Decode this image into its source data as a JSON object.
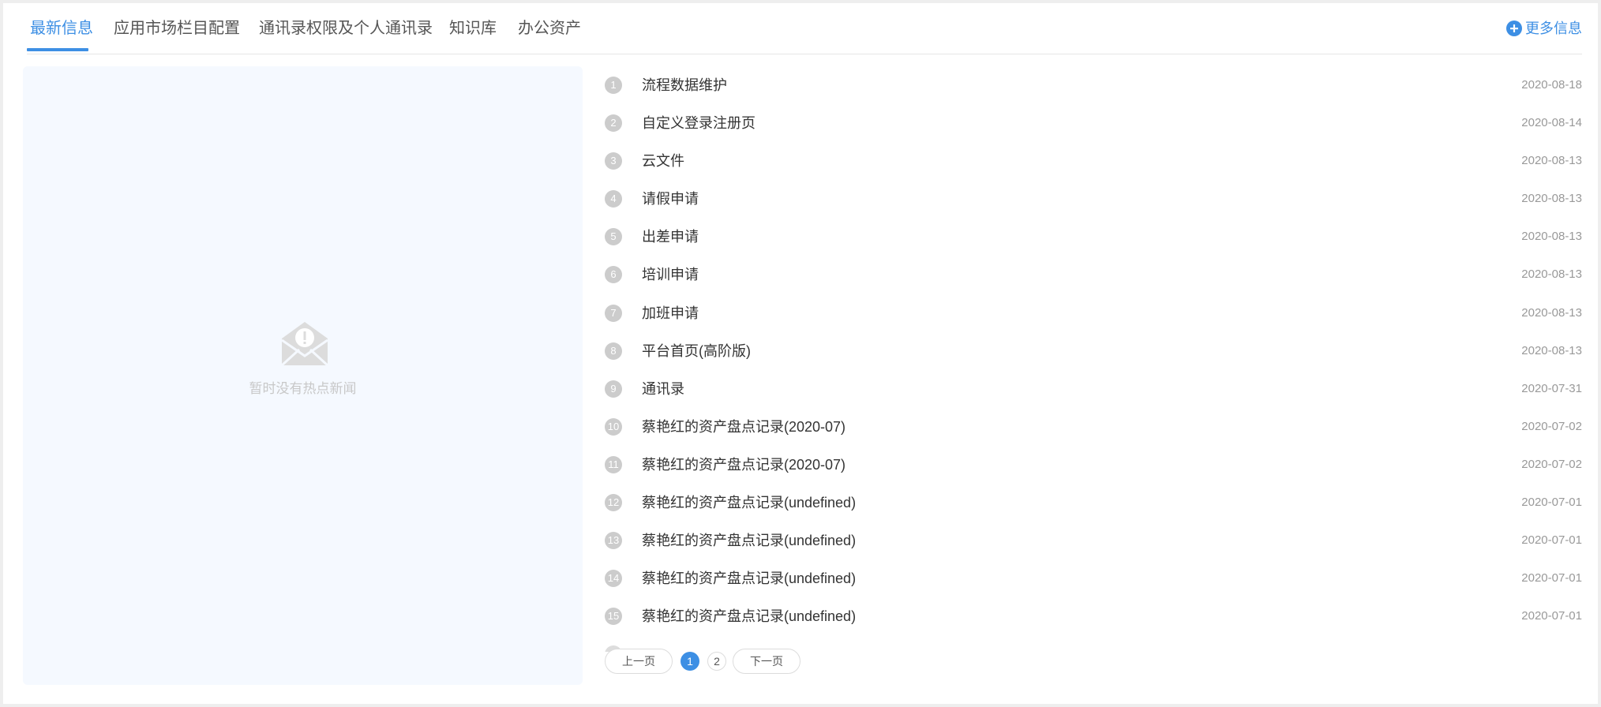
{
  "tabs": [
    {
      "label": "最新信息",
      "active": true
    },
    {
      "label": "应用市场栏目配置",
      "active": false
    },
    {
      "label": "通讯录权限及个人通讯录",
      "active": false
    },
    {
      "label": "知识库",
      "active": false
    },
    {
      "label": "办公资产",
      "active": false
    }
  ],
  "more": {
    "label": "更多信息",
    "icon": "plus-circle-icon"
  },
  "empty_panel": {
    "text": "暂时没有热点新闻",
    "icon": "mail-warning-icon"
  },
  "news": [
    {
      "num": "1",
      "title": "流程数据维护",
      "date": "2020-08-18"
    },
    {
      "num": "2",
      "title": "自定义登录注册页",
      "date": "2020-08-14"
    },
    {
      "num": "3",
      "title": "云文件",
      "date": "2020-08-13"
    },
    {
      "num": "4",
      "title": "请假申请",
      "date": "2020-08-13"
    },
    {
      "num": "5",
      "title": "出差申请",
      "date": "2020-08-13"
    },
    {
      "num": "6",
      "title": "培训申请",
      "date": "2020-08-13"
    },
    {
      "num": "7",
      "title": "加班申请",
      "date": "2020-08-13"
    },
    {
      "num": "8",
      "title": "平台首页(高阶版)",
      "date": "2020-08-13"
    },
    {
      "num": "9",
      "title": "通讯录",
      "date": "2020-07-31"
    },
    {
      "num": "10",
      "title": "蔡艳红的资产盘点记录(2020-07)",
      "date": "2020-07-02"
    },
    {
      "num": "11",
      "title": "蔡艳红的资产盘点记录(2020-07)",
      "date": "2020-07-02"
    },
    {
      "num": "12",
      "title": "蔡艳红的资产盘点记录(undefined)",
      "date": "2020-07-01"
    },
    {
      "num": "13",
      "title": "蔡艳红的资产盘点记录(undefined)",
      "date": "2020-07-01"
    },
    {
      "num": "14",
      "title": "蔡艳红的资产盘点记录(undefined)",
      "date": "2020-07-01"
    },
    {
      "num": "15",
      "title": "蔡艳红的资产盘点记录(undefined)",
      "date": "2020-07-01"
    }
  ],
  "pagination": {
    "prev_label": "上一页",
    "next_label": "下一页",
    "pages": [
      "1",
      "2"
    ],
    "current": "1"
  },
  "colors": {
    "accent": "#3d8fe4",
    "badge": "#cccccc",
    "panel_bg": "#f5f9ff"
  }
}
